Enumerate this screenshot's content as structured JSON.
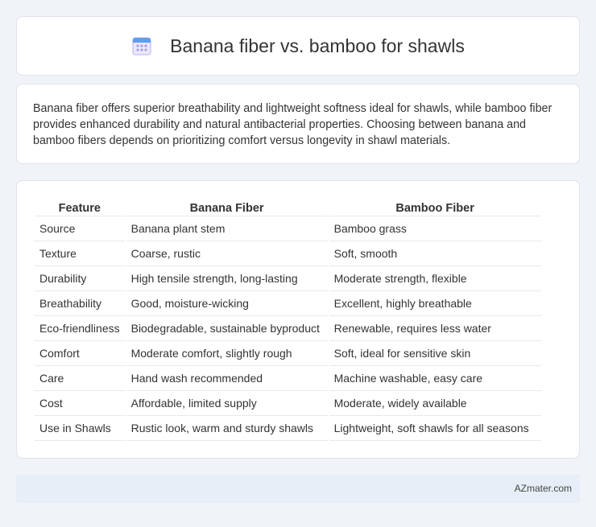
{
  "header": {
    "title": "Banana fiber vs. bamboo for shawls",
    "icon": "calendar-grid-icon",
    "icon_color": "#8a80d8"
  },
  "summary": {
    "text": "Banana fiber offers superior breathability and lightweight softness ideal for shawls, while bamboo fiber provides enhanced durability and natural antibacterial properties. Choosing between banana and bamboo fibers depends on prioritizing comfort versus longevity in shawl materials."
  },
  "table": {
    "headers": [
      "Feature",
      "Banana Fiber",
      "Bamboo Fiber"
    ],
    "rows": [
      [
        "Source",
        "Banana plant stem",
        "Bamboo grass"
      ],
      [
        "Texture",
        "Coarse, rustic",
        "Soft, smooth"
      ],
      [
        "Durability",
        "High tensile strength, long-lasting",
        "Moderate strength, flexible"
      ],
      [
        "Breathability",
        "Good, moisture-wicking",
        "Excellent, highly breathable"
      ],
      [
        "Eco-friendliness",
        "Biodegradable, sustainable byproduct",
        "Renewable, requires less water"
      ],
      [
        "Comfort",
        "Moderate comfort, slightly rough",
        "Soft, ideal for sensitive skin"
      ],
      [
        "Care",
        "Hand wash recommended",
        "Machine washable, easy care"
      ],
      [
        "Cost",
        "Affordable, limited supply",
        "Moderate, widely available"
      ],
      [
        "Use in Shawls",
        "Rustic look, warm and sturdy shawls",
        "Lightweight, soft shawls for all seasons"
      ]
    ]
  },
  "footer": {
    "site": "AZmater.com"
  }
}
